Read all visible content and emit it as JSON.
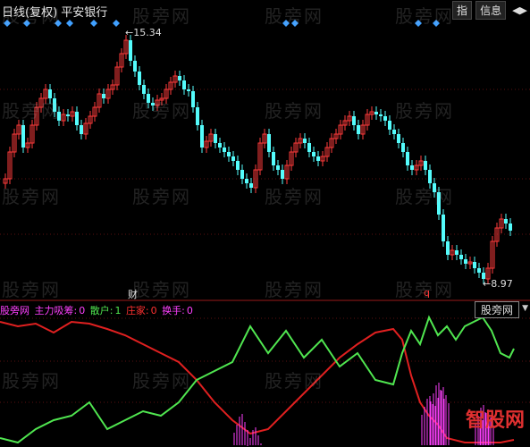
{
  "header": {
    "title": "日线(复权)  平安银行",
    "btn_index": "指",
    "btn_info": "信息",
    "arrows": "◀▶"
  },
  "price_panel": {
    "high_label": "15.34",
    "low_label": "8.97",
    "marker_cai": "财",
    "marker_q": "q"
  },
  "indicator": {
    "name": "股旁网",
    "main_label": "主力吸筹:",
    "main_value": "0",
    "retail_label": "散户:",
    "retail_value": "1",
    "dealer_label": "庄家:",
    "dealer_value": "0",
    "turnover_label": "换手:",
    "turnover_value": "0",
    "tab_label": "股旁网"
  },
  "watermark": "股旁网",
  "logo_text": "智股网",
  "colors": {
    "up": "#ff3b3b",
    "down": "#54fcfc",
    "green_line": "#50e650",
    "red_line": "#e02020",
    "magenta": "#ff40ff"
  }
}
